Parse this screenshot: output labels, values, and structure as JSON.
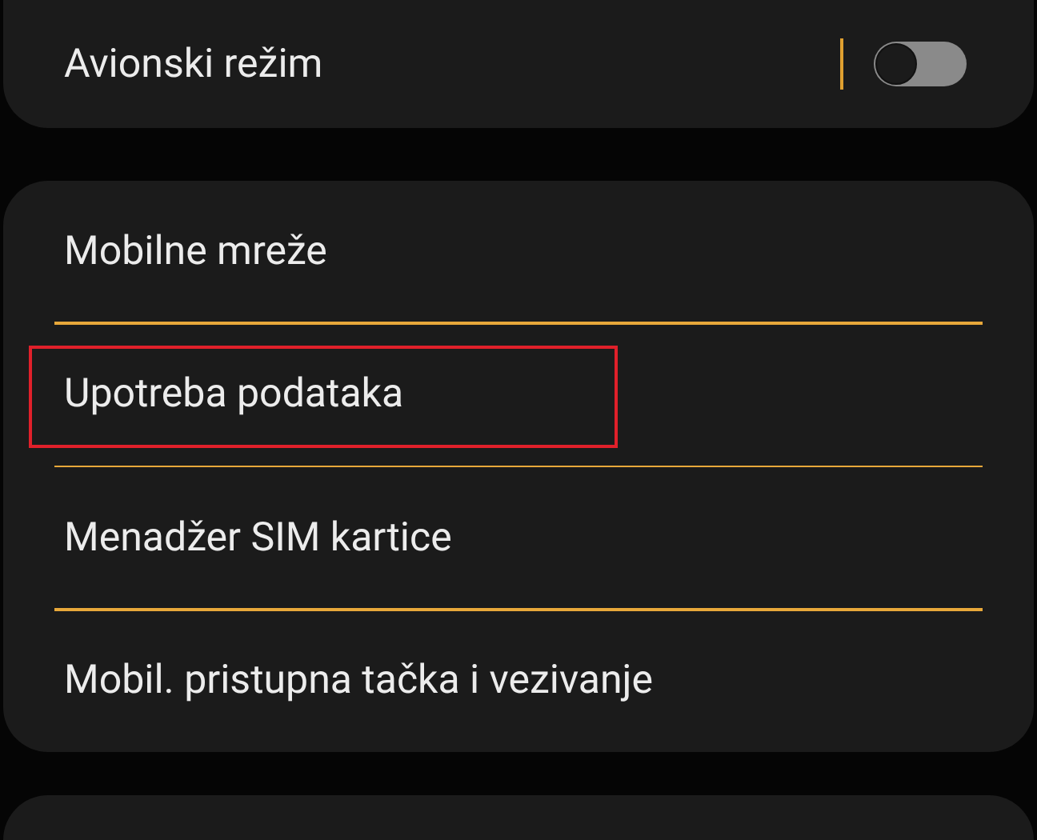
{
  "airplane_mode": {
    "label": "Avionski režim",
    "on": false
  },
  "connections": [
    {
      "label": "Mobilne mreže",
      "highlighted": false
    },
    {
      "label": "Upotreba podataka",
      "highlighted": true
    },
    {
      "label": "Menadžer SIM kartice",
      "highlighted": false
    },
    {
      "label": "Mobil. pristupna tačka i vezivanje",
      "highlighted": false
    }
  ]
}
